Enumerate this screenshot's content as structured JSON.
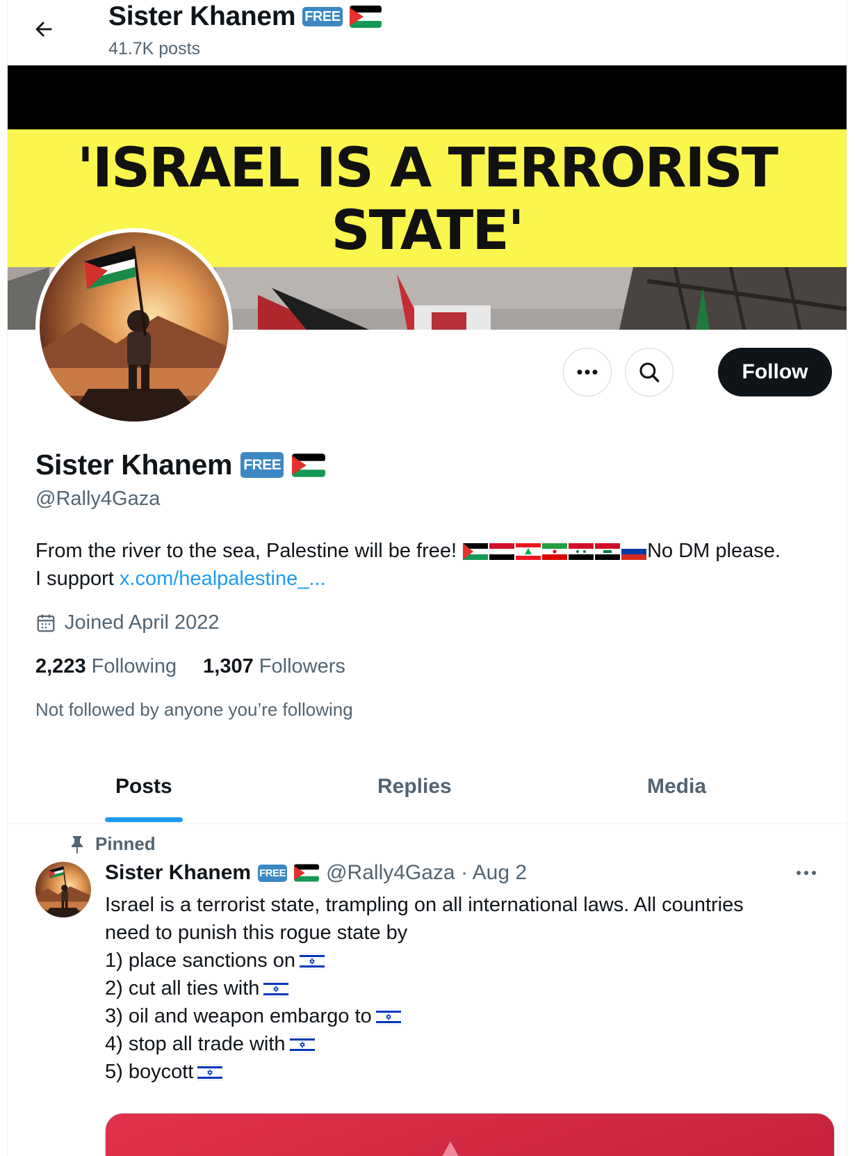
{
  "header": {
    "display_name": "Sister Khanem",
    "free_badge": "FREE",
    "post_count": "41.7K posts"
  },
  "banner": {
    "headline_line1": "'ISRAEL IS A TERRORIST",
    "headline_line2": "STATE'"
  },
  "actions": {
    "more_icon": "more-horizontal-icon",
    "search_icon": "search-icon",
    "follow_label": "Follow"
  },
  "profile": {
    "display_name": "Sister Khanem",
    "free_badge": "FREE",
    "handle": "@Rally4Gaza",
    "bio_text": "From the river to the sea, Palestine will be free!",
    "bio_suffix": "No DM please.",
    "bio_support_prefix": "I support",
    "bio_link": "x.com/healpalestine_...",
    "joined": "Joined April 2022",
    "following_count": "2,223",
    "following_label": "Following",
    "followers_count": "1,307",
    "followers_label": "Followers",
    "not_followed": "Not followed by anyone you’re following"
  },
  "tabs": [
    {
      "label": "Posts",
      "active": true
    },
    {
      "label": "Replies",
      "active": false
    },
    {
      "label": "Media",
      "active": false
    }
  ],
  "pinned_post": {
    "pinned_label": "Pinned",
    "author": "Sister Khanem",
    "free_badge": "FREE",
    "handle_date": "@Rally4Gaza · Aug 2",
    "line1": "Israel is a terrorist state, trampling on all international laws. All countries",
    "line2": "need to punish this rogue state by",
    "line3": "1) place sanctions on",
    "line4": "2) cut all ties with",
    "line5": "3) oil and weapon embargo to",
    "line6": "4) stop all trade with",
    "line7": "5) boycott"
  },
  "colors": {
    "accent": "#1d9bf0",
    "text_secondary": "#536471",
    "banner_yellow": "#fbf64d",
    "free_badge": "#3b88c3"
  }
}
